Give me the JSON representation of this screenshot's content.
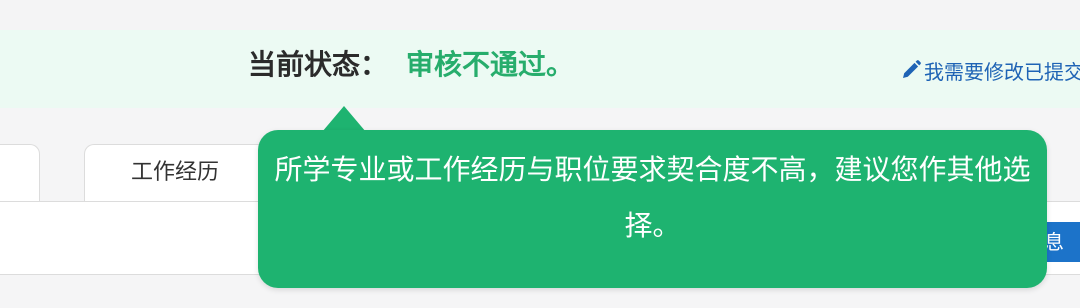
{
  "status": {
    "label": "当前状态：",
    "value": "审核不通过。",
    "value_color": "#27ad6c"
  },
  "edit_link": {
    "icon": "pencil-icon",
    "label": "我需要修改已提交"
  },
  "tabs": [
    {
      "label": ""
    },
    {
      "label": "工作经历"
    }
  ],
  "side_button": {
    "label": "息"
  },
  "tooltip": {
    "message": "所学专业或工作经历与职位要求契合度不高，建议您作其他选择。",
    "background_color": "#1eb370"
  },
  "colors": {
    "status_band": "#ecfaf3",
    "link_blue": "#1e63b5",
    "button_blue": "#1c73c9"
  }
}
